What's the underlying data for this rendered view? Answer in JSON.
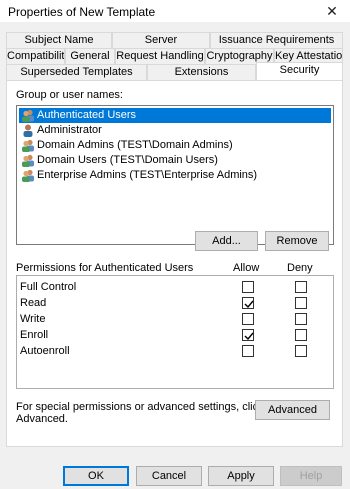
{
  "window": {
    "title": "Properties of New Template",
    "close_glyph": "✕"
  },
  "tabs": {
    "row1": [
      "Subject Name",
      "Server",
      "Issuance Requirements"
    ],
    "row2": [
      "Compatibility",
      "General",
      "Request Handling",
      "Cryptography",
      "Key Attestation"
    ],
    "row3": [
      "Superseded Templates",
      "Extensions",
      "Security"
    ],
    "active": "Security"
  },
  "security": {
    "group_label": "Group or user names:",
    "users": [
      {
        "name": "Authenticated Users",
        "icon": "group-icon",
        "selected": true
      },
      {
        "name": "Administrator",
        "icon": "user-icon",
        "selected": false
      },
      {
        "name": "Domain Admins (TEST\\Domain Admins)",
        "icon": "group-icon",
        "selected": false
      },
      {
        "name": "Domain Users (TEST\\Domain Users)",
        "icon": "group-icon",
        "selected": false
      },
      {
        "name": "Enterprise Admins (TEST\\Enterprise Admins)",
        "icon": "group-icon",
        "selected": false
      }
    ],
    "add_label": "Add...",
    "remove_label": "Remove",
    "perm_header": "Permissions for Authenticated Users",
    "allow_header": "Allow",
    "deny_header": "Deny",
    "permissions": [
      {
        "name": "Full Control",
        "allow": false,
        "deny": false
      },
      {
        "name": "Read",
        "allow": true,
        "deny": false
      },
      {
        "name": "Write",
        "allow": false,
        "deny": false
      },
      {
        "name": "Enroll",
        "allow": true,
        "deny": false
      },
      {
        "name": "Autoenroll",
        "allow": false,
        "deny": false
      }
    ],
    "special_text_1": "For special permissions or advanced settings, click",
    "special_text_2": "Advanced.",
    "advanced_label": "Advanced"
  },
  "footer": {
    "ok": "OK",
    "cancel": "Cancel",
    "apply": "Apply",
    "help": "Help"
  },
  "colors": {
    "selection": "#0078d7",
    "panel": "#ffffff",
    "dialog": "#f0f0f0"
  }
}
